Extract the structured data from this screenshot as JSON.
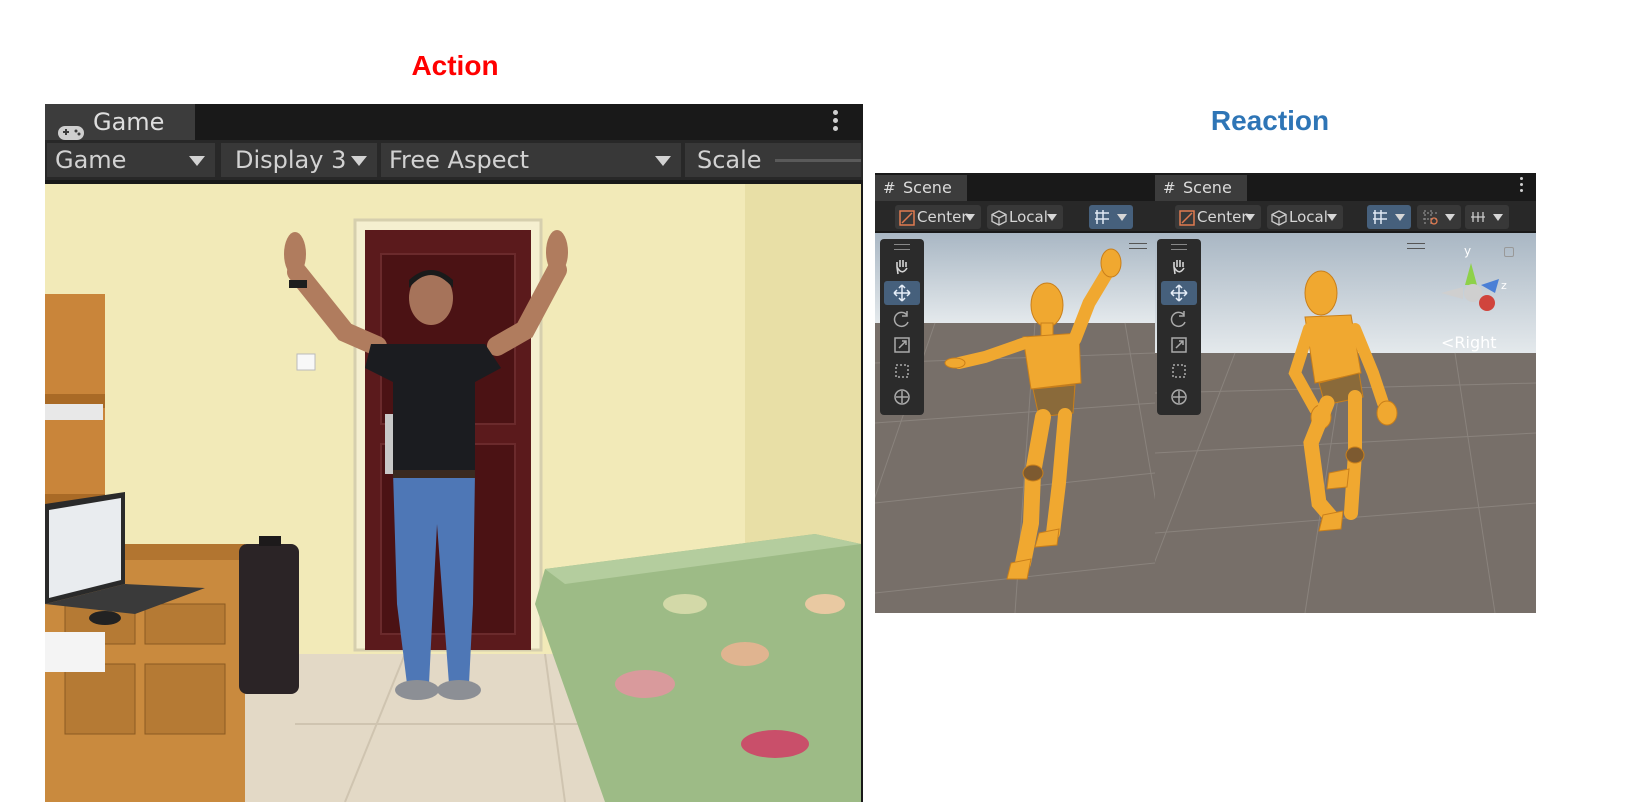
{
  "headings": {
    "action": "Action",
    "reaction": "Reaction"
  },
  "game_window": {
    "tab_label": "Game",
    "tab_icon": "gamepad-icon",
    "toolbar": {
      "view_select": "Game",
      "display_select": "Display 3",
      "aspect_select": "Free Aspect",
      "scale_label": "Scale"
    }
  },
  "scene_windows": [
    {
      "tab_label": "Scene",
      "pivot_select": "Center",
      "space_select": "Local"
    },
    {
      "tab_label": "Scene",
      "pivot_select": "Center",
      "space_select": "Local",
      "gizmo": {
        "y_label": "y",
        "z_label": "z",
        "view_label": "Right"
      }
    }
  ],
  "tools": [
    "hand-tool",
    "move-tool",
    "rotate-tool",
    "scale-tool",
    "rect-tool",
    "transform-tool"
  ],
  "colors": {
    "action_heading": "#ff0000",
    "reaction_heading": "#2e75b6",
    "editor_bg": "#191919",
    "tab_bg": "#3c3c3c",
    "active_tool": "#46607c",
    "mannequin": "#f0a830"
  }
}
